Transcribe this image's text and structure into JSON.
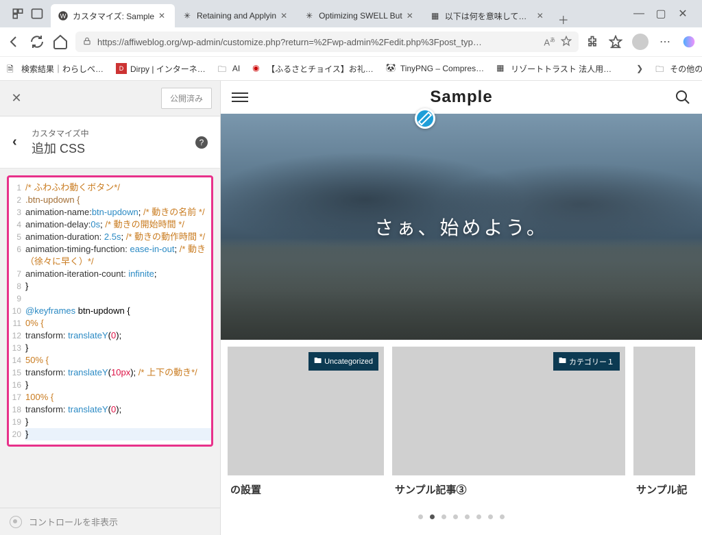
{
  "tabs": [
    {
      "label": "カスタマイズ: Sample",
      "active": true
    },
    {
      "label": "Retaining and Applyin"
    },
    {
      "label": "Optimizing SWELL But"
    },
    {
      "label": "以下は何を意味していま"
    }
  ],
  "url": "https://affiweblog.org/wp-admin/customize.php?return=%2Fwp-admin%2Fedit.php%3Fpost_typ…",
  "bookmarks": [
    {
      "label": "検索結果｜わらしべ…"
    },
    {
      "label": "Dirpy | インターネ…"
    },
    {
      "label": "AI"
    },
    {
      "label": "【ふるさとチョイス】お礼…"
    },
    {
      "label": "TinyPNG – Compres…"
    },
    {
      "label": "リゾートトラスト 法人用…"
    }
  ],
  "other_bookmarks": "その他のお気に入り",
  "customizer": {
    "publish": "公開済み",
    "subtitle": "カスタマイズ中",
    "title": "追加 CSS",
    "hide_controls": "コントロールを非表示"
  },
  "code": {
    "l1": "/* ふわふわ動くボタン*/",
    "l2": ".btn-updown {",
    "l3a": "animation-name:",
    "l3b": "btn-updown",
    "l3c": "; ",
    "l3d": "/* 動きの名前 */",
    "l4a": "animation-delay:",
    "l4b": "0s",
    "l4c": "; ",
    "l4d": "/* 動きの開始時間 */",
    "l5a": "animation-duration: ",
    "l5b": "2.5s",
    "l5c": "; ",
    "l5d": "/* 動きの動作時間 */",
    "l6a": "animation-timing-function: ",
    "l6b": "ease-in-out",
    "l6c": "; ",
    "l6d": "/* 動き（徐々に早く）*/",
    "l7a": "animation-iteration-count: ",
    "l7b": "infinite",
    "l7c": ";",
    "l8": "}",
    "l10a": "@keyframes",
    "l10b": " btn-updown {",
    "l11": "0% {",
    "l12a": "transform: ",
    "l12b": "translateY",
    "l12c": "(",
    "l12d": "0",
    "l12e": ");",
    "l13": "}",
    "l14": "50% {",
    "l15a": "transform: ",
    "l15b": "translateY",
    "l15c": "(",
    "l15d": "10px",
    "l15e": "); ",
    "l15f": "/* 上下の動き*/",
    "l16": "}",
    "l17": "100% {",
    "l18a": "transform: ",
    "l18b": "translateY",
    "l18c": "(",
    "l18d": "0",
    "l18e": ");",
    "l19": "}",
    "l20": "}"
  },
  "preview": {
    "site_title": "Sample",
    "hero_text": "さぁ、始めよう。",
    "cards": [
      {
        "title": "の設置",
        "category": "Uncategorized"
      },
      {
        "title": "サンプル記事③",
        "category": "カテゴリー１"
      },
      {
        "title": "サンプル記"
      }
    ]
  }
}
